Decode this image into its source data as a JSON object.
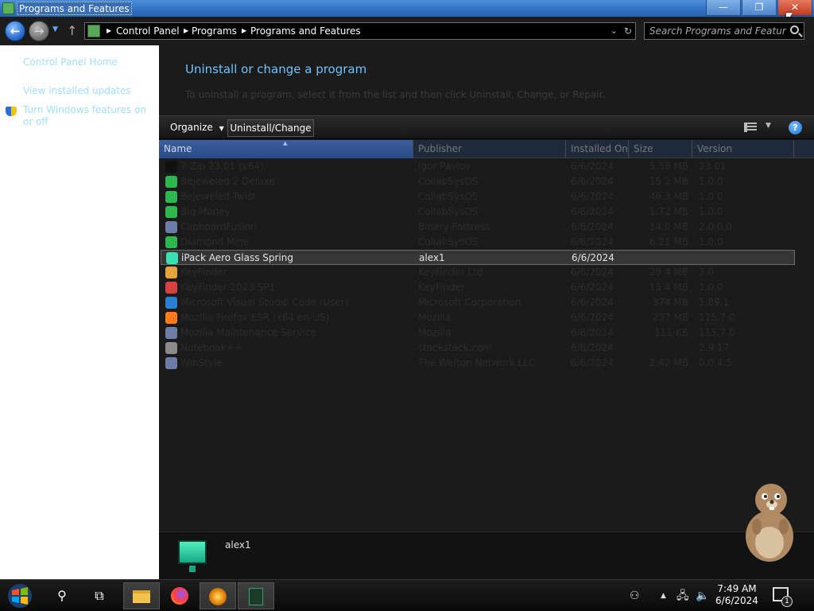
{
  "window": {
    "title": "Programs and Features",
    "min_glyph": "—",
    "max_glyph": "❐",
    "close_glyph": "✕"
  },
  "address": {
    "crumbs": [
      "Control Panel",
      "Programs",
      "Programs and Features"
    ],
    "search_placeholder": "Search Programs and Features"
  },
  "nav": {
    "back_glyph": "←",
    "fwd_glyph": "→",
    "up_glyph": "↑",
    "hist_glyph": "▼"
  },
  "left_pane": {
    "links": [
      "Control Panel Home",
      "View installed updates",
      "Turn Windows features on or off"
    ]
  },
  "main": {
    "heading": "Uninstall or change a program",
    "instruction": "To uninstall a program, select it from the list and then click Uninstall, Change, or Repair."
  },
  "toolbar": {
    "organize": "Organize",
    "uninstall_change": "Uninstall/Change",
    "help": "?"
  },
  "columns": [
    "Name",
    "Publisher",
    "Installed On",
    "Size",
    "Version"
  ],
  "programs": [
    {
      "name": "7-Zip 23.01 (x64)",
      "publisher": "Igor Pavlov",
      "installed": "6/6/2024",
      "size": "5.58 MB",
      "version": "23.01",
      "icon": "7z-icon",
      "color": "#111111"
    },
    {
      "name": "Bejeweled 2 Deluxe",
      "publisher": "CollabSysOS",
      "installed": "6/6/2024",
      "size": "15.2 MB",
      "version": "1.0.0",
      "icon": "game-icon",
      "color": "#2db84d"
    },
    {
      "name": "Bejeweled Twist",
      "publisher": "CollabSysOS",
      "installed": "6/6/2024",
      "size": "46.3 MB",
      "version": "1.0.0",
      "icon": "game-icon",
      "color": "#2db84d"
    },
    {
      "name": "Big Money",
      "publisher": "CollabSysOS",
      "installed": "6/6/2024",
      "size": "1.72 MB",
      "version": "1.0.0",
      "icon": "game-icon",
      "color": "#2db84d"
    },
    {
      "name": "ClipboardFusion",
      "publisher": "Binary Fortress",
      "installed": "6/6/2024",
      "size": "14.0 MB",
      "version": "2.0.0.0",
      "icon": "installer-icon",
      "color": "#6c7ea8"
    },
    {
      "name": "Diamond Mine",
      "publisher": "CollabSysOS",
      "installed": "6/6/2024",
      "size": "6.21 MB",
      "version": "1.0.0",
      "icon": "game-icon",
      "color": "#2db84d"
    },
    {
      "name": "iPack Aero Glass Spring",
      "publisher": "alex1",
      "installed": "6/6/2024",
      "size": "",
      "version": "",
      "icon": "monitor-icon",
      "color": "#38e0b0",
      "selected": true
    },
    {
      "name": "KeyFinder",
      "publisher": "KeyFinder Ltd",
      "installed": "6/6/2024",
      "size": "28.4 MB",
      "version": "3.0",
      "icon": "key-icon",
      "color": "#e8a33a"
    },
    {
      "name": "KeyFinder 2023 SP1",
      "publisher": "KeyFinder",
      "installed": "6/6/2024",
      "size": "15.4 MB",
      "version": "1.0.0",
      "icon": "pinwheel-icon",
      "color": "#d94040"
    },
    {
      "name": "Microsoft Visual Studio Code (User)",
      "publisher": "Microsoft Corporation",
      "installed": "6/6/2024",
      "size": "374 MB",
      "version": "1.89.1",
      "icon": "vscode-icon",
      "color": "#2a7fd4"
    },
    {
      "name": "Mozilla Firefox ESR (x64 en-US)",
      "publisher": "Mozilla",
      "installed": "6/6/2024",
      "size": "237 MB",
      "version": "115.7.0",
      "icon": "firefox-icon",
      "color": "#ff7a1a"
    },
    {
      "name": "Mozilla Maintenance Service",
      "publisher": "Mozilla",
      "installed": "6/6/2024",
      "size": "111 KB",
      "version": "115.7.0",
      "icon": "installer-icon",
      "color": "#6c7ea8"
    },
    {
      "name": "Notebook++",
      "publisher": "stackstack.com",
      "installed": "6/6/2024",
      "size": "",
      "version": "2.9.17",
      "icon": "app-icon",
      "color": "#8a8a8a"
    },
    {
      "name": "WinStyle",
      "publisher": "The Welton Network LLC",
      "installed": "6/6/2024",
      "size": "2.42 MB",
      "version": "0.0.4.5",
      "icon": "installer-icon",
      "color": "#6c7ea8"
    }
  ],
  "details": {
    "publisher": "alex1"
  },
  "taskbar": {
    "search_glyph": "⚲",
    "taskview_glyph": "⧉",
    "time": "7:49 AM",
    "date": "6/6/2024",
    "notif_count": "1",
    "tray_people": "⚇",
    "tray_up": "▲",
    "tray_net": "🖧",
    "tray_vol": "🔈"
  }
}
